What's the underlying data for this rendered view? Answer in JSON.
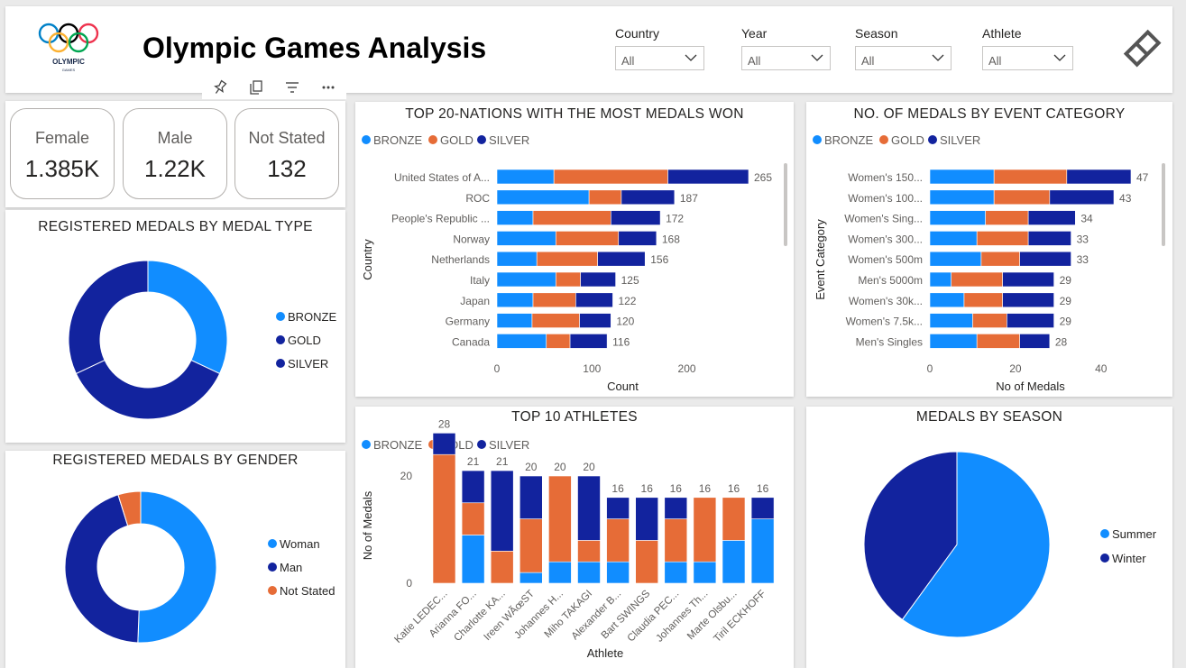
{
  "header": {
    "logo_text": "OLYMPIC",
    "logo_sub": "GAMES",
    "title": "Olympic Games Analysis",
    "filters": [
      {
        "label": "Country",
        "value": "All"
      },
      {
        "label": "Year",
        "value": "All"
      },
      {
        "label": "Season",
        "value": "All"
      },
      {
        "label": "Athlete",
        "value": "All"
      }
    ]
  },
  "toolbar": {
    "icons": [
      "pin-icon",
      "copy-icon",
      "filter-icon",
      "more-icon"
    ]
  },
  "cards": [
    {
      "label": "Female",
      "value": "1.385K"
    },
    {
      "label": "Male",
      "value": "1.22K"
    },
    {
      "label": "Not Stated",
      "value": "132"
    }
  ],
  "colors": {
    "bronze": "#118dff",
    "gold": "#e66c37",
    "silver": "#12239e"
  },
  "chart_data": [
    {
      "id": "medal-type",
      "type": "pie",
      "variant": "donut",
      "title": "REGISTERED MEDALS BY MEDAL TYPE",
      "labels": [
        "BRONZE",
        "GOLD",
        "SILVER"
      ],
      "values": [
        32,
        36,
        32
      ],
      "colors": [
        "#118dff",
        "#12239e",
        "#12239e"
      ],
      "legend_colors": [
        "#118dff",
        "#12239e",
        "#12239e"
      ],
      "legend": "right"
    },
    {
      "id": "gender",
      "type": "pie",
      "variant": "donut",
      "title": "REGISTERED MEDALS BY GENDER",
      "labels": [
        "Woman",
        "Man",
        "Not Stated"
      ],
      "values": [
        1385,
        1220,
        132
      ],
      "colors": [
        "#118dff",
        "#12239e",
        "#e66c37"
      ],
      "legend": "right"
    },
    {
      "id": "nations",
      "type": "bar",
      "orientation": "horizontal",
      "stacked": true,
      "title": "TOP 20-NATIONS WITH THE MOST MEDALS WON",
      "xlabel": "Count",
      "ylabel": "Country",
      "xlim": [
        0,
        265
      ],
      "xticks": [
        0,
        100,
        200
      ],
      "categories": [
        "United States of A...",
        "ROC",
        "People's Republic ...",
        "Norway",
        "Netherlands",
        "Italy",
        "Japan",
        "Germany",
        "Canada"
      ],
      "series": [
        {
          "name": "BRONZE",
          "values": [
            60,
            97,
            38,
            62,
            42,
            62,
            38,
            37,
            52
          ]
        },
        {
          "name": "GOLD",
          "values": [
            120,
            34,
            82,
            66,
            64,
            26,
            45,
            50,
            25
          ]
        },
        {
          "name": "SILVER",
          "values": [
            85,
            56,
            52,
            40,
            50,
            37,
            39,
            33,
            39
          ]
        }
      ],
      "totals": [
        265,
        187,
        172,
        168,
        156,
        125,
        122,
        120,
        116
      ],
      "legend": "top-left"
    },
    {
      "id": "event-category",
      "type": "bar",
      "orientation": "horizontal",
      "stacked": true,
      "title": "NO. OF MEDALS BY EVENT CATEGORY",
      "xlabel": "No of Medals",
      "ylabel": "Event Category",
      "xlim": [
        0,
        47
      ],
      "xticks": [
        0,
        20,
        40
      ],
      "categories": [
        "Women's 150...",
        "Women's 100...",
        "Women's Sing...",
        "Women's 300...",
        "Women's 500m",
        "Men's 5000m",
        "Women's 30k...",
        "Women's 7.5k...",
        "Men's Singles"
      ],
      "series": [
        {
          "name": "BRONZE",
          "values": [
            15,
            15,
            13,
            11,
            12,
            5,
            8,
            10,
            11
          ]
        },
        {
          "name": "GOLD",
          "values": [
            17,
            13,
            10,
            12,
            9,
            12,
            9,
            8,
            10
          ]
        },
        {
          "name": "SILVER",
          "values": [
            15,
            15,
            11,
            10,
            12,
            12,
            12,
            11,
            7
          ]
        }
      ],
      "totals": [
        47,
        43,
        34,
        33,
        33,
        29,
        29,
        29,
        28
      ],
      "legend": "top-left"
    },
    {
      "id": "athletes",
      "type": "bar",
      "orientation": "vertical",
      "stacked": true,
      "title": "TOP 10 ATHLETES",
      "xlabel": "Athlete",
      "ylabel": "No of Medals",
      "ylim": [
        0,
        28
      ],
      "yticks": [
        0,
        20
      ],
      "categories": [
        "Katie LEDEC...",
        "Arianna FO...",
        "Charlotte KA...",
        "Ireen WÃœST",
        "Johannes H...",
        "Miho TAKAGI",
        "Alexander B...",
        "Bart SWINGS",
        "Claudia PEC...",
        "Johannes Th...",
        "Marte Olsbu...",
        "Tiril ECKHOFF"
      ],
      "series": [
        {
          "name": "BRONZE",
          "values": [
            0,
            9,
            0,
            2,
            4,
            4,
            4,
            0,
            4,
            4,
            8,
            12
          ]
        },
        {
          "name": "GOLD",
          "values": [
            24,
            6,
            6,
            10,
            16,
            4,
            8,
            8,
            8,
            12,
            8,
            0
          ]
        },
        {
          "name": "SILVER",
          "values": [
            4,
            6,
            15,
            8,
            0,
            12,
            4,
            8,
            4,
            0,
            0,
            4
          ]
        }
      ],
      "totals": [
        28,
        21,
        21,
        20,
        20,
        20,
        16,
        16,
        16,
        16,
        16,
        16
      ],
      "legend": "top-left"
    },
    {
      "id": "season",
      "type": "pie",
      "title": "MEDALS BY SEASON",
      "labels": [
        "Summer",
        "Winter"
      ],
      "values": [
        60,
        40
      ],
      "colors": [
        "#118dff",
        "#12239e"
      ],
      "legend": "right"
    }
  ]
}
